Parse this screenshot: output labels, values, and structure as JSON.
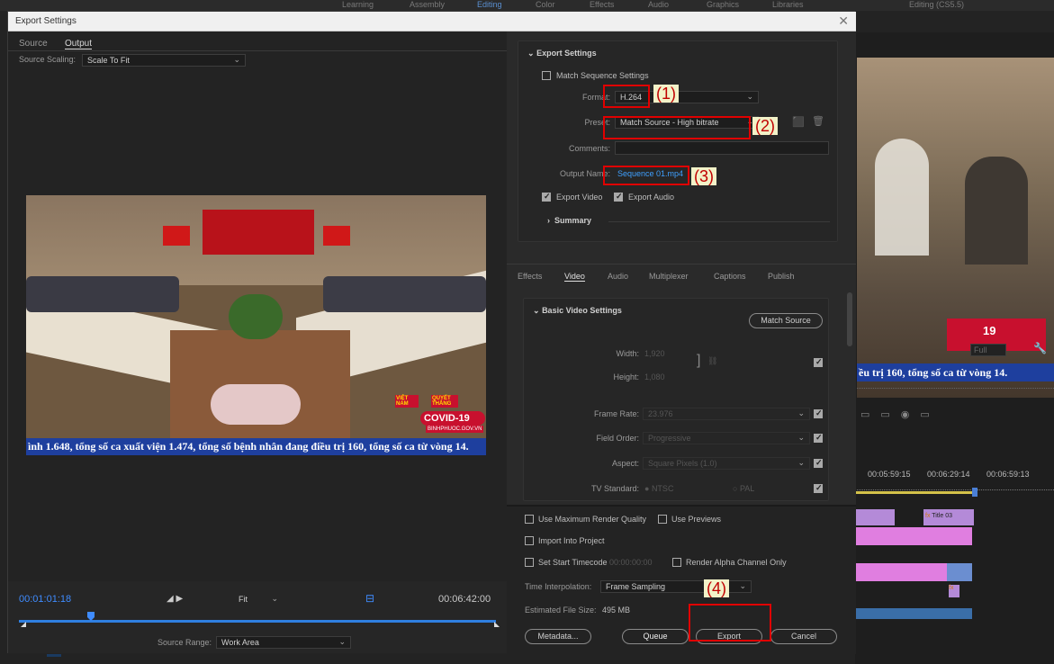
{
  "background": {
    "top_tabs": [
      "Learning",
      "Assembly",
      "Editing",
      "Color",
      "Effects",
      "Audio",
      "Graphics",
      "Libraries",
      "Editing (CS5.5)"
    ],
    "timecodes": [
      "00:05:59:15",
      "00:06:29:14",
      "00:06:59:13"
    ],
    "clip_label": "Title 03",
    "mon_zoom": "Full",
    "news_ticker": "ều trị 160, tổng số ca từ vòng 14."
  },
  "dialog": {
    "title": "Export Settings"
  },
  "source": {
    "tabs": [
      "Source",
      "Output"
    ],
    "scaling_label": "Source Scaling:",
    "scaling_value": "Scale To Fit",
    "ticker": "ình 1.648, tổng số ca xuất viện 1.474, tổng số bệnh nhân đang điều trị 160, tổng số ca từ vòng 14.",
    "banner_covid": "COVID-19",
    "banner_site": "BINHPHUOC.GOV.VN",
    "banner_viet": "VIỆT NAM",
    "banner_quyet": "QUYẾT THẮNG"
  },
  "transport": {
    "current_time": "00:01:01:18",
    "fit_label": "Fit",
    "duration": "00:06:42:00",
    "source_range_label": "Source Range:",
    "source_range_value": "Work Area",
    "track": "A3"
  },
  "export": {
    "section_title": "Export Settings",
    "match_sequence": "Match Sequence Settings",
    "format_label": "Format:",
    "format_value": "H.264",
    "preset_label": "Preset:",
    "preset_value": "Match Source - High bitrate",
    "comments_label": "Comments:",
    "output_name_label": "Output Name:",
    "output_name_value": "Sequence 01.mp4",
    "export_video": "Export Video",
    "export_audio": "Export Audio",
    "summary": "Summary"
  },
  "annotations": [
    "(1)",
    "(2)",
    "(3)",
    "(4)"
  ],
  "subtabs": [
    "Effects",
    "Video",
    "Audio",
    "Multiplexer",
    "Captions",
    "Publish"
  ],
  "video": {
    "section": "Basic Video Settings",
    "match_source": "Match Source",
    "width_label": "Width:",
    "width_value": "1,920",
    "height_label": "Height:",
    "height_value": "1,080",
    "frame_rate_label": "Frame Rate:",
    "frame_rate_value": "23.976",
    "field_order_label": "Field Order:",
    "field_order_value": "Progressive",
    "aspect_label": "Aspect:",
    "aspect_value": "Square Pixels (1.0)",
    "tv_standard_label": "TV Standard:",
    "ntsc": "NTSC",
    "pal": "PAL"
  },
  "bottom": {
    "max_render": "Use Maximum Render Quality",
    "use_previews": "Use Previews",
    "import_project": "Import Into Project",
    "start_timecode": "Set Start Timecode",
    "start_timecode_value": "00:00:00:00",
    "render_alpha": "Render Alpha Channel Only",
    "interp_label": "Time Interpolation:",
    "interp_value": "Frame Sampling",
    "filesize_label": "Estimated File Size:",
    "filesize_value": "495 MB",
    "metadata": "Metadata...",
    "queue": "Queue",
    "export": "Export",
    "cancel": "Cancel"
  }
}
